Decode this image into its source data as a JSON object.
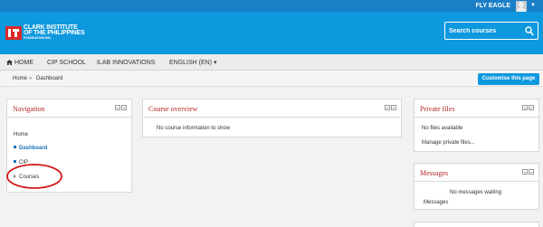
{
  "user": {
    "name": "FLY EAGLE"
  },
  "logo": {
    "line1": "CLARK INSTITUTE",
    "line2": "OF THE PHILIPPINES",
    "line3": "FOUNDATION INC."
  },
  "search": {
    "placeholder": "Search courses"
  },
  "nav": {
    "items": [
      {
        "label": "HOME"
      },
      {
        "label": "CIP SCHOOL"
      },
      {
        "label": "ILAB INNOVATIONS"
      },
      {
        "label": "ENGLISH (EN) ▾"
      }
    ]
  },
  "breadcrumb": {
    "home": "Home",
    "separator": "»",
    "current": "Dashboard"
  },
  "customise_label": "Customise this page",
  "navigation_block": {
    "title": "Navigation",
    "items": [
      {
        "label": "Home"
      },
      {
        "label": "Dashboard"
      },
      {
        "label": "CIP"
      },
      {
        "label": "Courses"
      }
    ]
  },
  "course_overview": {
    "title": "Course overview",
    "message": "No course information to show"
  },
  "private_files": {
    "title": "Private files",
    "empty": "No files available",
    "manage": "Manage private files..."
  },
  "messages": {
    "title": "Messages",
    "none": "No messages waiting",
    "link": "Messages"
  },
  "colors": {
    "topbar": "#1a7fc7",
    "banner": "#0e98de",
    "block_title": "#b42626",
    "link": "#1670b8",
    "annotation": "#d01818"
  }
}
